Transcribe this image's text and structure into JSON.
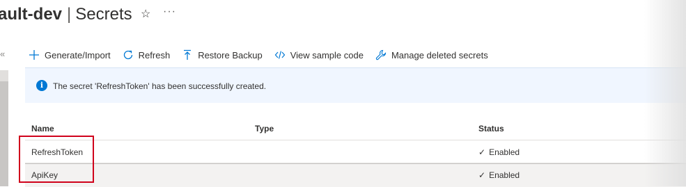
{
  "header": {
    "resource_name": "ault-dev",
    "separator": "|",
    "page_title": "Secrets",
    "favorite_icon": "star-icon",
    "more_label": "···"
  },
  "sidebar": {
    "collapse_label": "«"
  },
  "toolbar": {
    "items": [
      {
        "label": "Generate/Import",
        "icon": "plus-icon"
      },
      {
        "label": "Refresh",
        "icon": "refresh-icon"
      },
      {
        "label": "Restore Backup",
        "icon": "upload-icon"
      },
      {
        "label": "View sample code",
        "icon": "code-icon"
      },
      {
        "label": "Manage deleted secrets",
        "icon": "wrench-icon"
      }
    ]
  },
  "banner": {
    "icon": "info-icon",
    "message": "The secret 'RefreshToken' has been successfully created."
  },
  "table": {
    "columns": {
      "name": "Name",
      "type": "Type",
      "status": "Status"
    },
    "rows": [
      {
        "name": "RefreshToken",
        "type": "",
        "status": "Enabled"
      },
      {
        "name": "ApiKey",
        "type": "",
        "status": "Enabled"
      }
    ]
  },
  "colors": {
    "accent": "#0078d4",
    "highlight": "#d0021b",
    "banner_bg": "#f0f6ff"
  }
}
